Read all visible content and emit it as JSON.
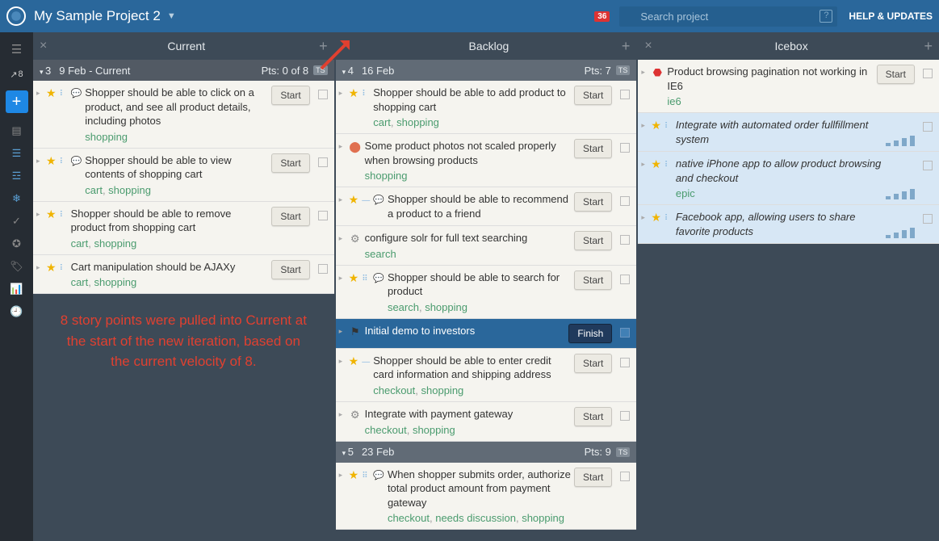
{
  "header": {
    "title": "My Sample Project 2",
    "searchPlaceholder": "Search project",
    "badge": "36",
    "help": "HELP & UPDATES",
    "velocity": "8"
  },
  "annotation": "8 story points were pulled into Current at the start of the new iteration, based on the current velocity of 8.",
  "panels": {
    "current": {
      "title": "Current",
      "iter": {
        "num": "3",
        "date": "9 Feb - Current",
        "pts": "Pts: 0 of 8",
        "badge": "TS"
      },
      "stories": [
        {
          "title": "Shopper should be able to click on a product, and see all product details, including photos",
          "tags": [
            "shopping"
          ],
          "btn": "Start",
          "star": true,
          "est": "⠇",
          "cmt": true
        },
        {
          "title": "Shopper should be able to view contents of shopping cart",
          "tags": [
            "cart",
            "shopping"
          ],
          "btn": "Start",
          "star": true,
          "est": "⠇",
          "cmt": true
        },
        {
          "title": "Shopper should be able to remove product from shopping cart",
          "tags": [
            "cart",
            "shopping"
          ],
          "btn": "Start",
          "star": true,
          "est": "⠇"
        },
        {
          "title": "Cart manipulation should be AJAXy",
          "tags": [
            "cart",
            "shopping"
          ],
          "btn": "Start",
          "star": true,
          "est": "⠇"
        }
      ]
    },
    "backlog": {
      "title": "Backlog",
      "iters": [
        {
          "num": "4",
          "date": "16 Feb",
          "pts": "Pts: 7",
          "badge": "TS",
          "stories": [
            {
              "title": "Shopper should be able to add product to shopping cart",
              "tags": [
                "cart",
                "shopping"
              ],
              "btn": "Start",
              "star": true,
              "est": "⠇"
            },
            {
              "title": "Some product photos not scaled properly when browsing products",
              "tags": [
                "shopping"
              ],
              "btn": "Start",
              "bug": true
            },
            {
              "title": "Shopper should be able to recommend a product to a friend",
              "tags": [],
              "btn": "Start",
              "star": true,
              "est": "—",
              "cmt": true
            },
            {
              "title": "configure solr for full text searching",
              "tags": [
                "search"
              ],
              "btn": "Start",
              "gear": true
            },
            {
              "title": "Shopper should be able to search for product",
              "tags": [
                "search",
                "shopping"
              ],
              "btn": "Start",
              "star": true,
              "est": "⠿",
              "cmt": true
            },
            {
              "title": "Initial demo to investors",
              "tags": [],
              "btn": "Finish",
              "flag": true,
              "dark": true
            },
            {
              "title": "Shopper should be able to enter credit card information and shipping address",
              "tags": [
                "checkout",
                "shopping"
              ],
              "btn": "Start",
              "star": true,
              "est": "—"
            },
            {
              "title": "Integrate with payment gateway",
              "tags": [
                "checkout",
                "shopping"
              ],
              "btn": "Start",
              "gear": true
            }
          ]
        },
        {
          "num": "5",
          "date": "23 Feb",
          "pts": "Pts: 9",
          "badge": "TS",
          "stories": [
            {
              "title": "When shopper submits order, authorize total product amount from payment gateway",
              "tags": [
                "checkout",
                "needs discussion",
                "shopping"
              ],
              "btn": "Start",
              "star": true,
              "est": "⠿",
              "cmt": true
            }
          ]
        }
      ]
    },
    "icebox": {
      "title": "Icebox",
      "stories": [
        {
          "title": "Product browsing pagination not working in IE6",
          "tags": [
            "ie6"
          ],
          "btn": "Start",
          "release": true
        },
        {
          "title": "Integrate with automated order fullfillment system",
          "tags": [],
          "italic": true,
          "blue": true,
          "star": true,
          "est": "⠇",
          "mini": true
        },
        {
          "title": "native iPhone app to allow product browsing and checkout",
          "tags": [
            "epic"
          ],
          "italic": true,
          "blue": true,
          "star": true,
          "est": "⠇",
          "mini": true
        },
        {
          "title": "Facebook app, allowing users to share favorite products",
          "tags": [],
          "italic": true,
          "blue": true,
          "star": true,
          "est": "⠇",
          "mini": true
        }
      ]
    }
  }
}
